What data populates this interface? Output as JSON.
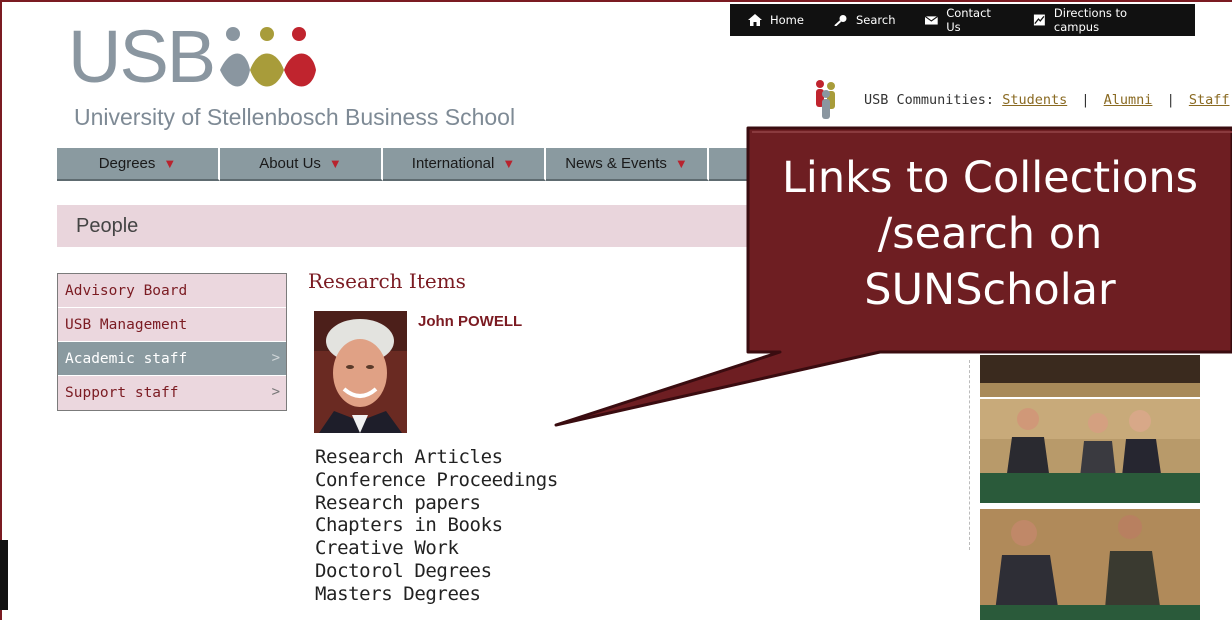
{
  "topbar": {
    "items": [
      {
        "label": "Home",
        "icon": "home-icon"
      },
      {
        "label": "Search",
        "icon": "search-icon"
      },
      {
        "label": "Contact Us",
        "icon": "envelope-icon"
      },
      {
        "label": "Directions to campus",
        "icon": "map-icon"
      }
    ]
  },
  "logo": {
    "acronym": "USB",
    "subtitle": "University of Stellenbosch Business School"
  },
  "communities": {
    "label": "USB Communities:",
    "links": [
      "Students",
      "Alumni",
      "Staff"
    ],
    "separator": "|"
  },
  "nav": {
    "items": [
      "Degrees",
      "About Us",
      "International",
      "News & Events",
      ""
    ]
  },
  "banner": {
    "title": "People"
  },
  "sidemenu": {
    "items": [
      {
        "label": "Advisory Board",
        "has_arrow": false,
        "active": false
      },
      {
        "label": "USB Management",
        "has_arrow": false,
        "active": false
      },
      {
        "label": "Academic staff",
        "has_arrow": true,
        "active": true
      },
      {
        "label": "Support staff",
        "has_arrow": true,
        "active": false
      }
    ],
    "arrow": ">"
  },
  "research": {
    "heading": "Research Items",
    "person_name": "John POWELL",
    "links": [
      "Research Articles",
      "Conference Proceedings",
      "Research papers",
      "Chapters in Books",
      "Creative Work",
      "Doctorol Degrees",
      "Masters Degrees"
    ]
  },
  "callout": {
    "line1": "Links to Collections",
    "line2": "/search on",
    "line3": "SUNScholar"
  },
  "colors": {
    "brand_maroon": "#7b1b22",
    "nav_grey": "#8a9aa0",
    "banner_pink": "#e9d5dc",
    "link_gold": "#8a6a22",
    "callout_fill": "#6e1e22"
  }
}
